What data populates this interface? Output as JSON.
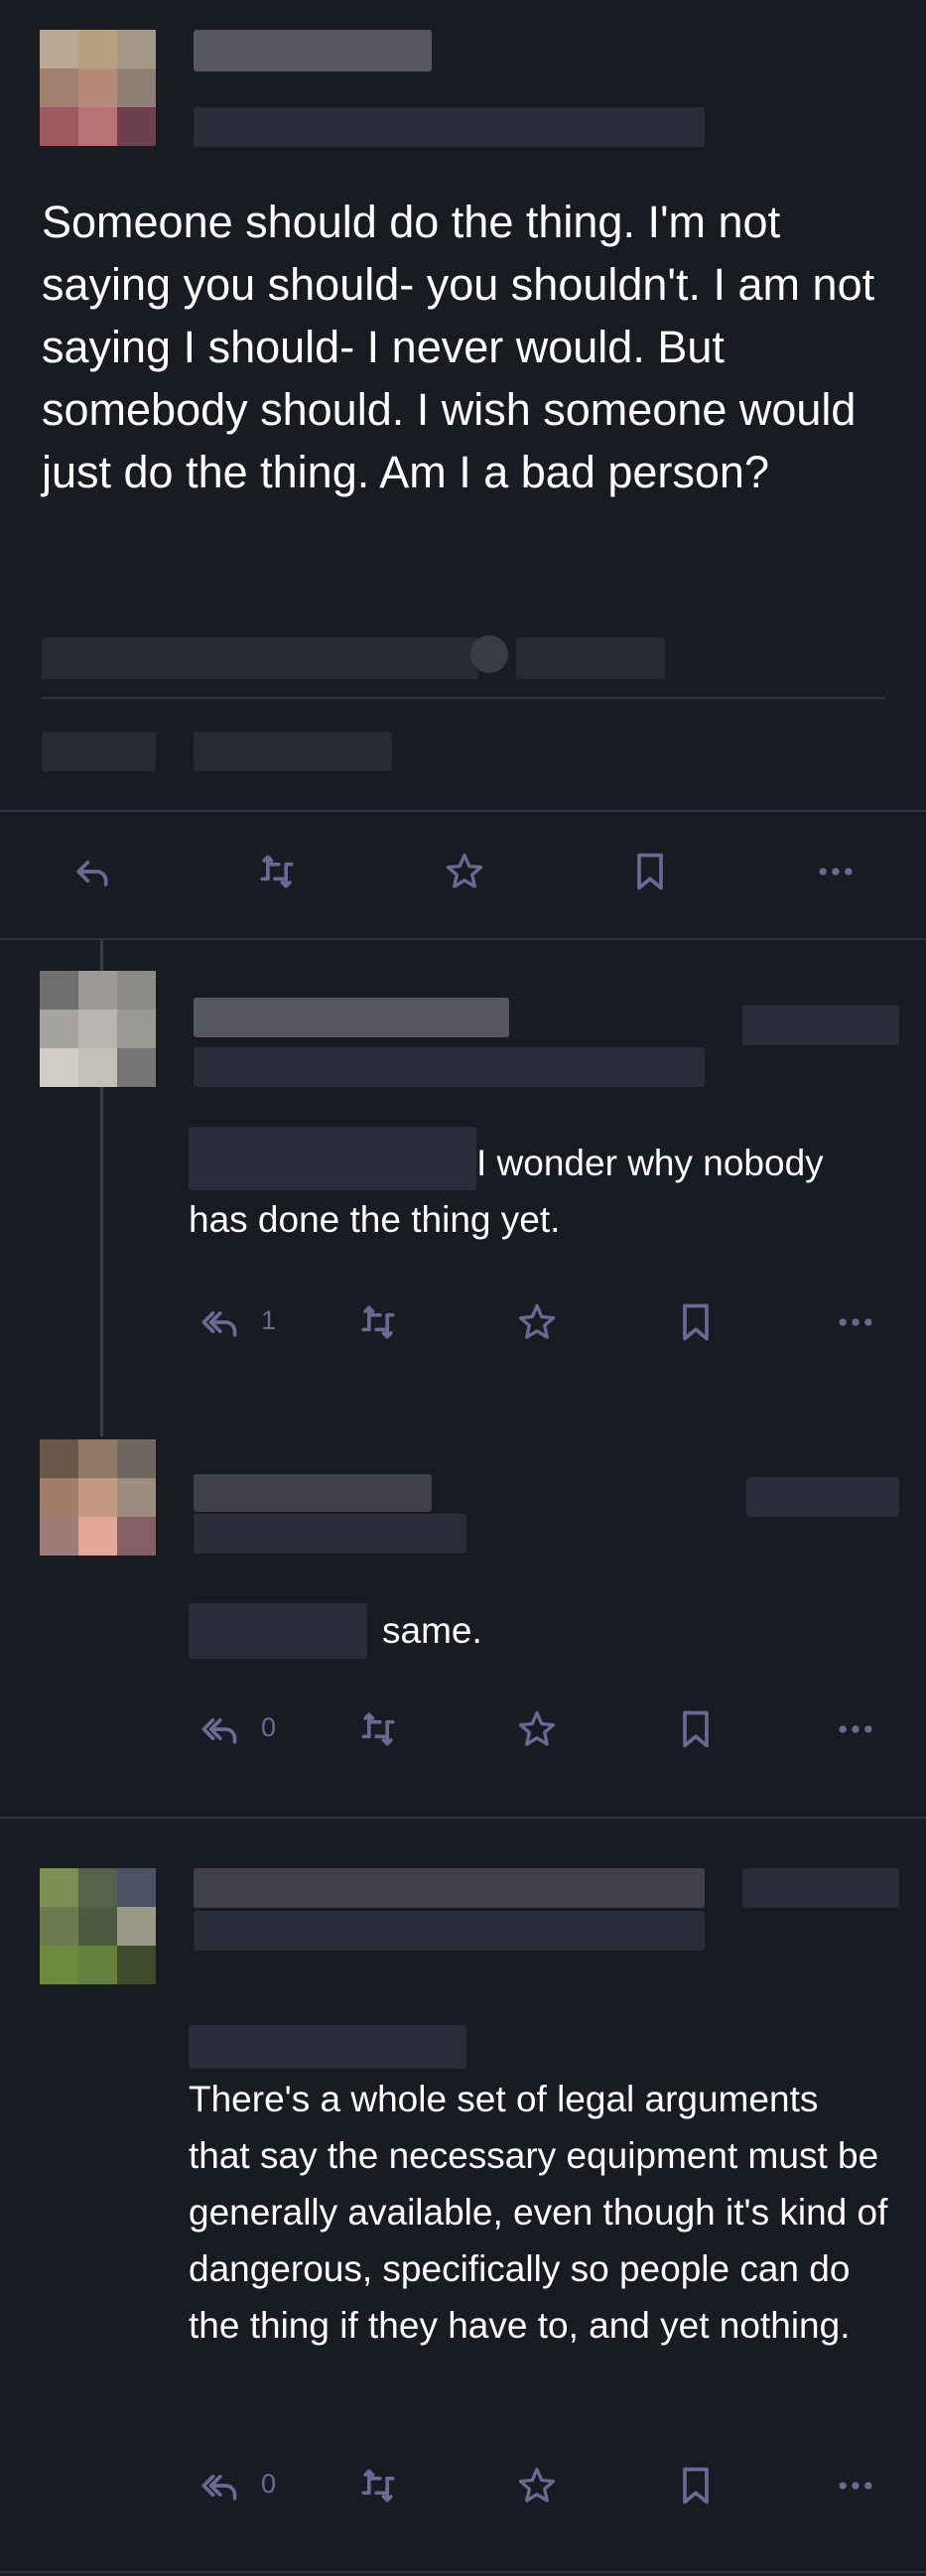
{
  "post": {
    "text": "Someone should do the thing. I'm not saying you should- you shouldn't. I am not saying I should- I never would. But somebody should. I wish someone would just do the thing. Am I a bad person?"
  },
  "replies": [
    {
      "text": "I wonder why nobody has done the thing yet.",
      "reply_count": "1"
    },
    {
      "text": "same.",
      "reply_count": "0"
    },
    {
      "text": "There's a whole set of legal arguments that say the necessary equipment must be generally available, even though it's kind of dangerous, specifically so people can do the thing if they have to, and yet nothing.",
      "reply_count": "0"
    }
  ],
  "icons": {
    "reply": "reply-icon",
    "reply_all": "reply-all-icon",
    "boost": "boost-icon",
    "favourite": "star-icon",
    "bookmark": "bookmark-icon",
    "more": "more-icon"
  },
  "colors": {
    "background": "#191b22",
    "icon": "#6c6994",
    "divider": "#2f3140"
  }
}
